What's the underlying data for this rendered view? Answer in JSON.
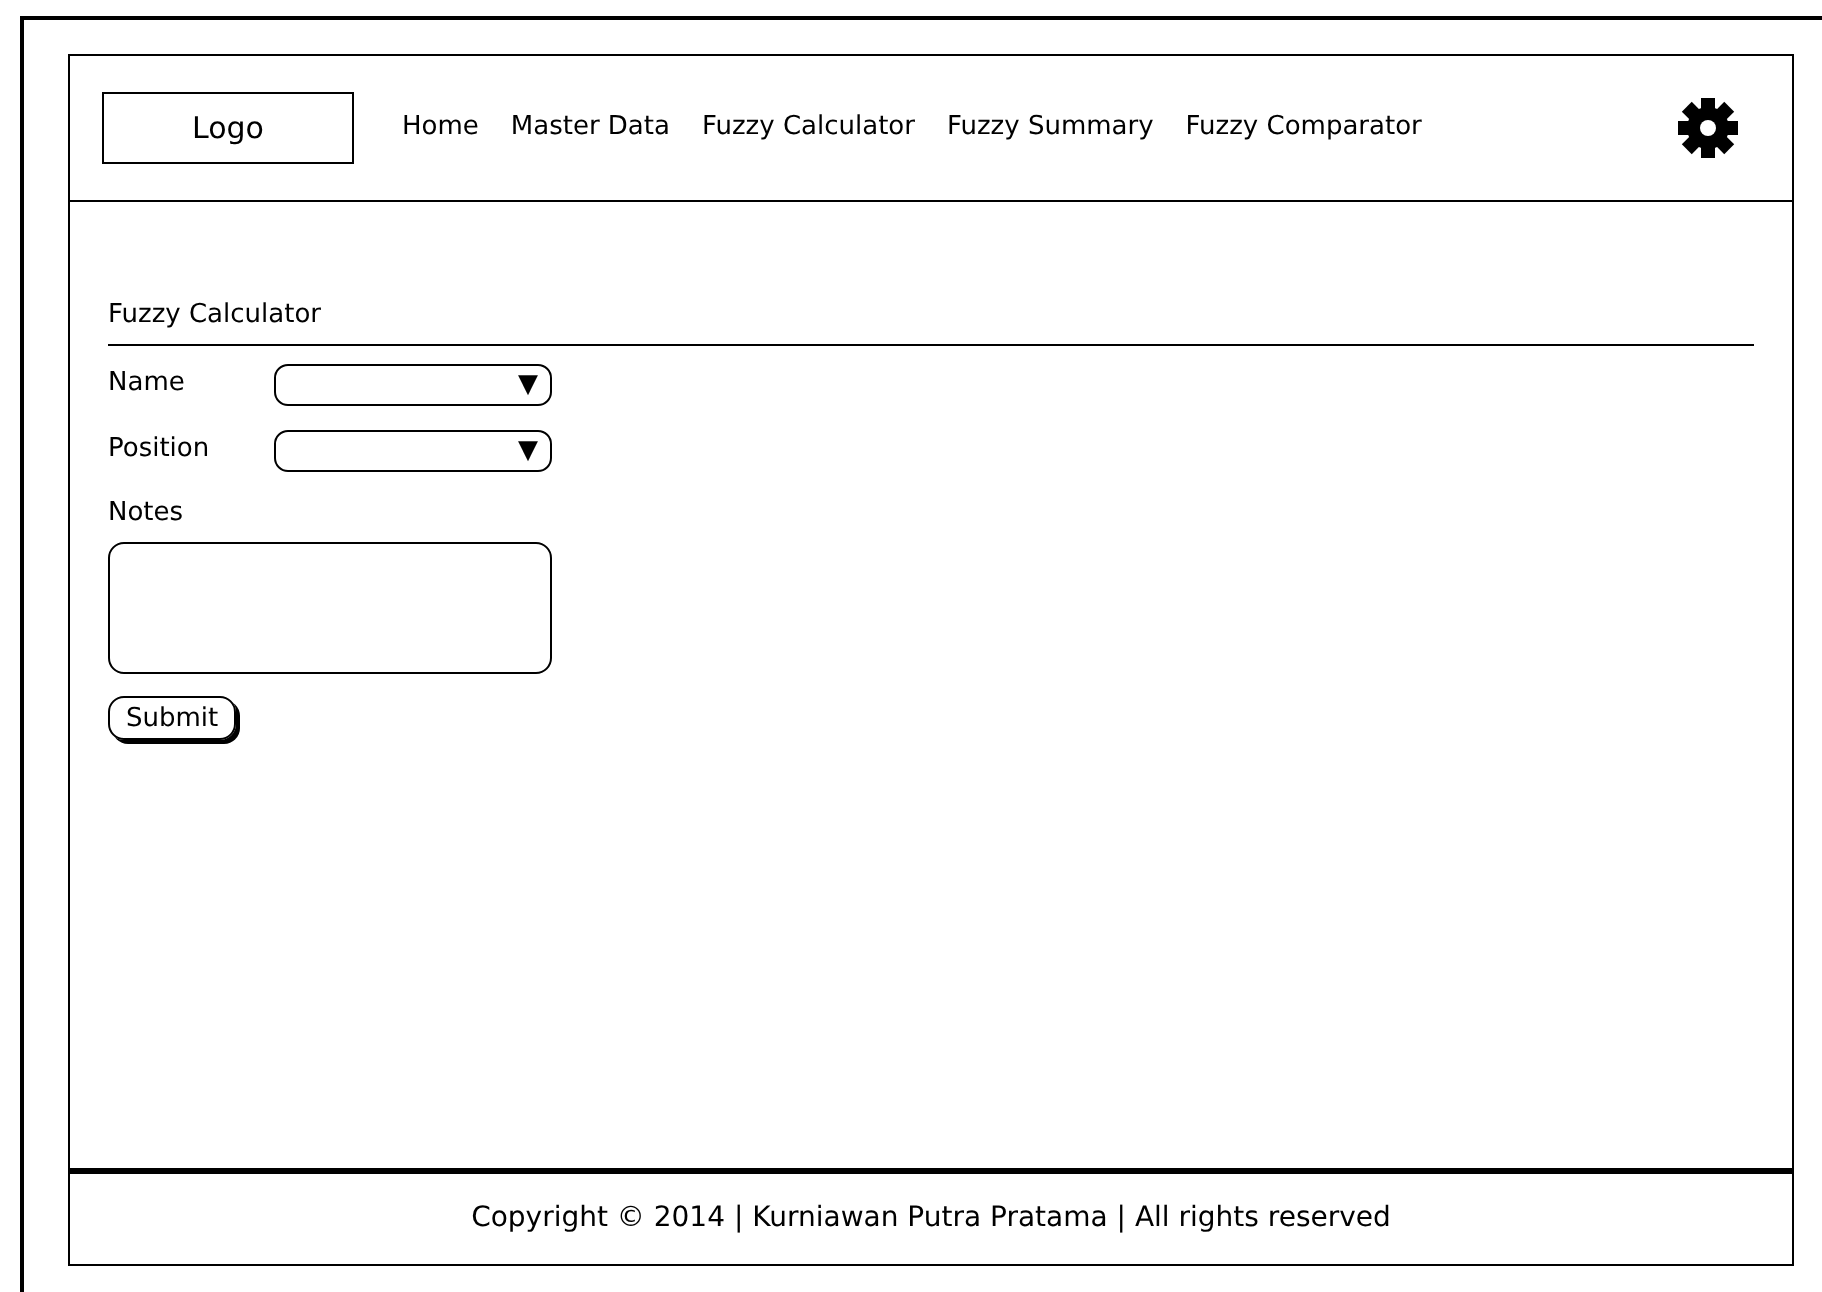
{
  "header": {
    "logo": "Logo",
    "nav": [
      "Home",
      "Master Data",
      "Fuzzy Calculator",
      "Fuzzy Summary",
      "Fuzzy Comparator"
    ]
  },
  "form": {
    "title": "Fuzzy Calculator",
    "fields": [
      {
        "kind": "select",
        "label": "Name",
        "arrow": "▼"
      },
      {
        "kind": "select",
        "label": "Position",
        "arrow": "▼"
      },
      {
        "kind": "textarea",
        "label": "Notes"
      }
    ],
    "submit": "Submit"
  },
  "footer": "Copyright © 2014 | Kurniawan Putra Pratama | All rights reserved"
}
